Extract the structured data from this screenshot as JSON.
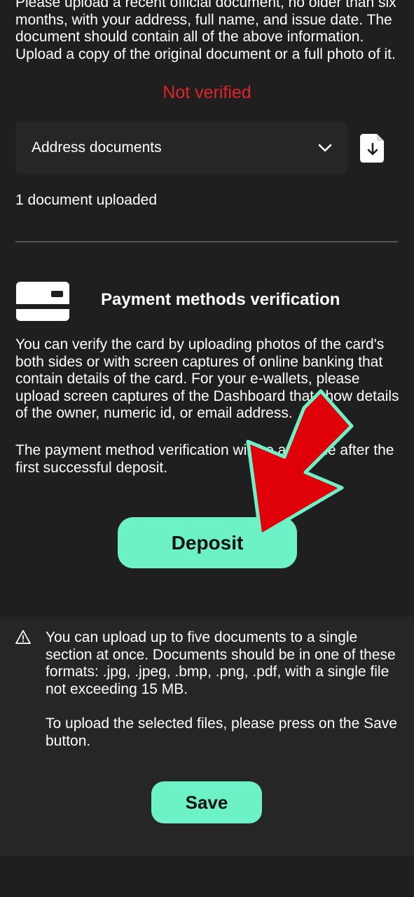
{
  "address_section": {
    "instructions": "Please upload a recent official document, no older than six months, with your address, full name, and issue date. The document should contain all of the above information. Upload a copy of the original document or a full photo of it.",
    "status": "Not verified",
    "status_color": "#e0242b",
    "document_type": {
      "selected": "Address documents",
      "icon": "chevron-down-icon"
    },
    "download_icon": "file-download-icon",
    "uploaded_count": "1 document uploaded"
  },
  "payment_section": {
    "icon": "credit-card-icon",
    "title": "Payment methods verification",
    "description": "You can verify the card by uploading photos of the card's both sides or with screen captures of online banking that contain details of the card. For your e-wallets, please upload screen captures of the Dashboard that show details of the owner, numeric id, or email address.",
    "note": "The payment method verification will be available after the first successful deposit.",
    "deposit_label": "Deposit"
  },
  "upload_info": {
    "icon": "warning-triangle-icon",
    "limits": "You can upload up to five documents to a single section at once. Documents should be in one of these formats: .jpg, .jpeg, .bmp, .png, .pdf, with a single file not exceeding 15 MB.",
    "save_hint": "To upload the selected files, please press on the Save button.",
    "save_label": "Save"
  },
  "colors": {
    "accent": "#6df2c8",
    "background": "#1f1f1f",
    "panel": "#262626",
    "annotation_arrow": "#e0000a"
  }
}
